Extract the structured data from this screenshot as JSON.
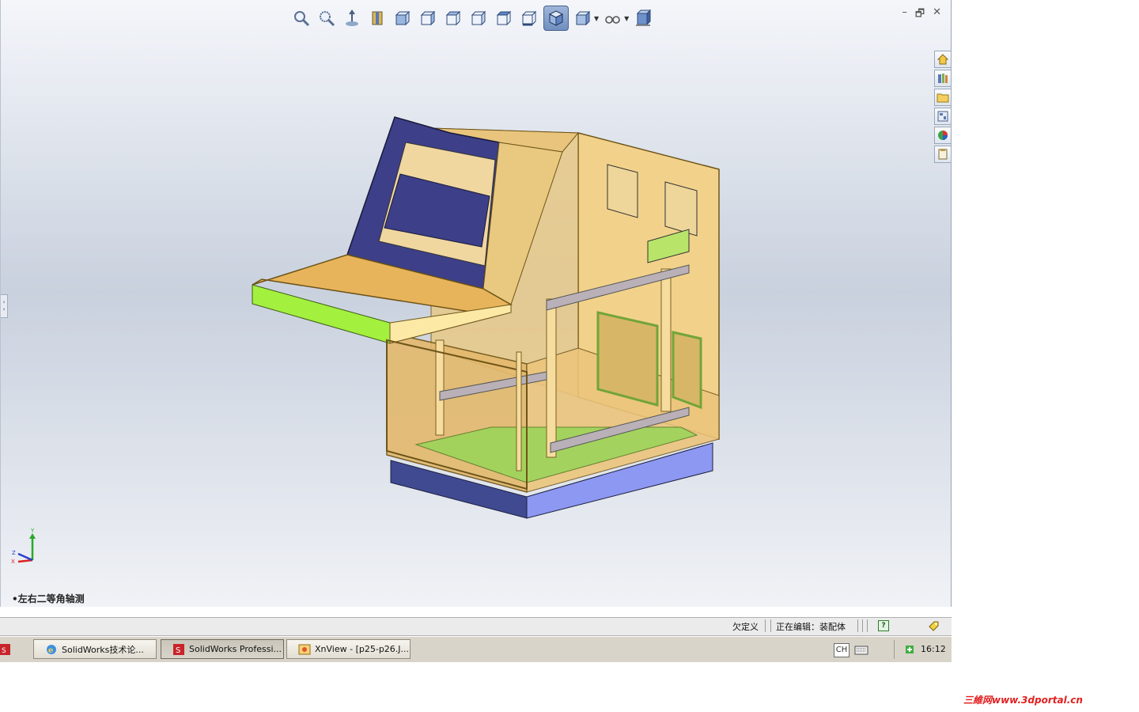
{
  "heads_up_toolbar": {
    "tools": [
      "zoom-to-fit",
      "zoom-to-area",
      "previous-view",
      "section-view",
      "view-orientation-front",
      "view-orientation-back",
      "view-orientation-left",
      "view-orientation-right",
      "view-orientation-top",
      "view-orientation-bottom",
      "isometric",
      "display-style",
      "hide-show-items",
      "apply-scene"
    ]
  },
  "window_controls": {
    "minimize": "–",
    "restore": "🗗",
    "close": "✕"
  },
  "view_name": "•左右二等角轴测",
  "triad": {
    "y": "Y",
    "x": "X",
    "z": "Z"
  },
  "status_bar": {
    "definition_state": "欠定义",
    "editing": "正在编辑：装配体",
    "help": "?"
  },
  "taskbar": {
    "buttons": [
      {
        "label": "SolidWorks技术论...",
        "icon": "ie-icon"
      },
      {
        "label": "SolidWorks Professi...",
        "icon": "solidworks-icon",
        "pressed": true
      },
      {
        "label": "XnView - [p25-p26.J...",
        "icon": "xnview-icon"
      }
    ],
    "language": "CH",
    "clock": "16:12"
  },
  "watermark": "三維网www.3dportal.cn",
  "colors": {
    "viewport_top": "#f4f6fa",
    "viewport_mid": "#c9d1de",
    "taskbar": "#d8d4c9"
  }
}
